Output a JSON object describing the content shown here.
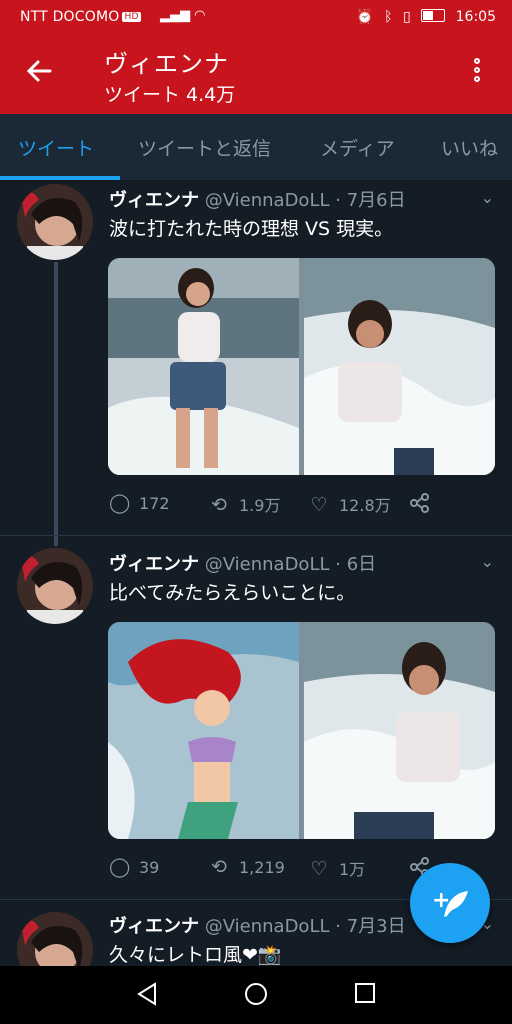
{
  "status_bar": {
    "carrier": "NTT DOCOMO",
    "carrier_badge": "HD",
    "time": "16:05"
  },
  "header": {
    "title": "ヴィエンナ",
    "subtitle": "ツイート 4.4万"
  },
  "tabs": [
    {
      "label": "ツイート",
      "active": true
    },
    {
      "label": "ツイートと返信",
      "active": false
    },
    {
      "label": "メディア",
      "active": false
    },
    {
      "label": "いいね",
      "active": false
    }
  ],
  "tweets": [
    {
      "name": "ヴィエンナ",
      "handle": "@ViennaDoLL",
      "date": "· 7月6日",
      "text": "波に打たれた時の理想 VS 現実。",
      "replies": "172",
      "retweets": "1.9万",
      "likes": "12.8万"
    },
    {
      "name": "ヴィエンナ",
      "handle": "@ViennaDoLL",
      "date": "· 6日",
      "text": "比べてみたらえらいことに。",
      "replies": "39",
      "retweets": "1,219",
      "likes": "1万"
    },
    {
      "name": "ヴィエンナ",
      "handle": "@ViennaDoLL",
      "date": "· 7月3日",
      "text": "久々にレトロ風❤📸"
    }
  ],
  "colors": {
    "brand_red": "#c8151d",
    "accent_blue": "#1da1f2",
    "background": "#141d26"
  }
}
